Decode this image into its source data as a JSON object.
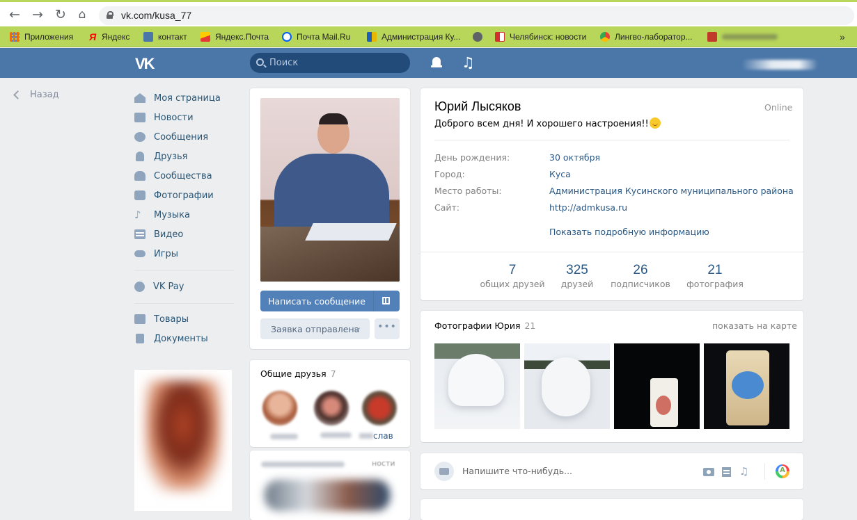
{
  "browser": {
    "url": "vk.com/kusa_77",
    "bookmarks": [
      {
        "label": "Приложения",
        "icon": "apps-grid-icon",
        "color": "#e8710a"
      },
      {
        "label": "Яндекс",
        "icon": "yandex-icon",
        "color": "#ff0000"
      },
      {
        "label": "контакт",
        "icon": "vk-icon",
        "color": "#4a76a8"
      },
      {
        "label": "Яндекс.Почта",
        "icon": "yandex-mail-icon",
        "color": "#ffcc00"
      },
      {
        "label": "Почта Mail.Ru",
        "icon": "mailru-icon",
        "color": "#005ff9"
      },
      {
        "label": "Администрация Ку...",
        "icon": "admin-icon",
        "color": "#c8a000"
      },
      {
        "label": "",
        "icon": "globe-icon",
        "color": "#5f6368"
      },
      {
        "label": "Челябинск: новости",
        "icon": "news-icon",
        "color": "#d32f2f"
      },
      {
        "label": "Лингво-лаборатор...",
        "icon": "chrome-icon",
        "color": "#4285f4"
      },
      {
        "label": "",
        "icon": "bookmark-icon",
        "color": "#c0392b"
      }
    ]
  },
  "header": {
    "logo": "VK",
    "search_placeholder": "Поиск"
  },
  "sidebar": {
    "back_label": "Назад",
    "items": [
      {
        "label": "Моя страница",
        "icon": "home-icon"
      },
      {
        "label": "Новости",
        "icon": "news-icon"
      },
      {
        "label": "Сообщения",
        "icon": "messages-icon"
      },
      {
        "label": "Друзья",
        "icon": "friends-icon"
      },
      {
        "label": "Сообщества",
        "icon": "groups-icon"
      },
      {
        "label": "Фотографии",
        "icon": "camera-icon"
      },
      {
        "label": "Музыка",
        "icon": "music-icon"
      },
      {
        "label": "Видео",
        "icon": "video-icon"
      },
      {
        "label": "Игры",
        "icon": "games-icon"
      }
    ],
    "pay_label": "VK Pay",
    "extra_items": [
      {
        "label": "Товары",
        "icon": "market-icon"
      },
      {
        "label": "Документы",
        "icon": "documents-icon"
      }
    ]
  },
  "profile_actions": {
    "write_message": "Написать сообщение",
    "request_sent": "Заявка отправлена",
    "more": "•••"
  },
  "common_friends": {
    "title": "Общие друзья",
    "count": "7",
    "visible_name_fragment": "слав",
    "section2_fragment": "ности"
  },
  "profile": {
    "name": "Юрий Лысяков",
    "online": "Online",
    "status": "Доброго всем дня! И хорошего настроения!!",
    "info": [
      {
        "key": "День рождения:",
        "value": "30 октября"
      },
      {
        "key": "Город:",
        "value": "Куса"
      },
      {
        "key": "Место работы:",
        "value": "Администрация Кусинского муниципального района"
      },
      {
        "key": "Сайт:",
        "value": "http://admkusa.ru"
      }
    ],
    "show_more": "Показать подробную информацию",
    "counters": [
      {
        "value": "7",
        "label": "общих друзей"
      },
      {
        "value": "325",
        "label": "друзей"
      },
      {
        "value": "26",
        "label": "подписчиков"
      },
      {
        "value": "21",
        "label": "фотография"
      }
    ]
  },
  "photos": {
    "title": "Фотографии Юрия",
    "count": "21",
    "map_link": "показать на карте"
  },
  "post_box": {
    "placeholder": "Напишите что-нибудь..."
  },
  "colors": {
    "vk_blue": "#4a76a8",
    "link": "#2a5885",
    "bookmarks_bar": "#b8d65a"
  }
}
